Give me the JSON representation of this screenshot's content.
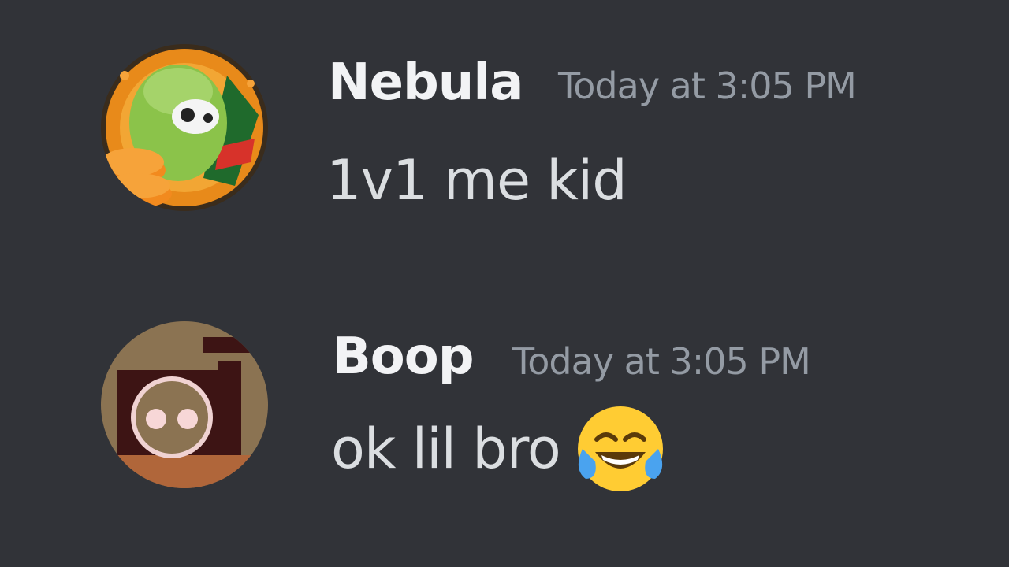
{
  "messages": [
    {
      "username": "Nebula",
      "timestamp": "Today at 3:05 PM",
      "text": "1v1 me kid",
      "avatar": "alpaca-mountain-dew-avatar"
    },
    {
      "username": "Boop",
      "timestamp": "Today at 3:05 PM",
      "text": "ok lil bro",
      "avatar": "robot-face-avatar",
      "emoji": "face-with-tears-of-joy-icon"
    }
  ],
  "colors": {
    "background": "#313338",
    "username": "#f2f3f5",
    "timestamp": "#949ba4",
    "text": "#dbdee1"
  }
}
